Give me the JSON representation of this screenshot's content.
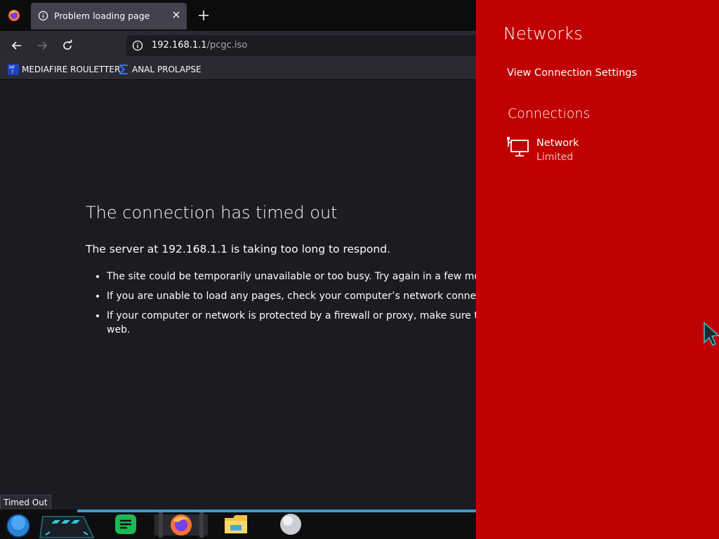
{
  "browser": {
    "tab": {
      "title": "Problem loading page"
    },
    "url": {
      "host": "192.168.1.1",
      "path": "/pcgc.iso"
    },
    "bookmarks": [
      {
        "label": "MEDIAFIRE ROULETTER",
        "icon": "mediafire-icon"
      },
      {
        "label": "ANAL PROLAPSE",
        "icon": "chevron-bookmark-icon"
      }
    ],
    "status_tooltip": "Timed Out"
  },
  "error_page": {
    "title": "The connection has timed out",
    "description": "The server at 192.168.1.1 is taking too long to respond.",
    "bullets": [
      "The site could be temporarily unavailable or too busy. Try again in a few momer",
      "If you are unable to load any pages, check your computer’s network connection.",
      "If your computer or network is protected by a firewall or proxy, make sure that F",
      "web."
    ]
  },
  "networks_panel": {
    "title": "Networks",
    "settings_link": "View Connection Settings",
    "connections_heading": "Connections",
    "connection": {
      "name": "Network",
      "status": "Limited"
    },
    "colors": {
      "background": "#c00000",
      "text": "#ffffff"
    }
  },
  "taskbar": {
    "icons": [
      "start-orb-icon",
      "task-view-icon",
      "spotify-icon",
      "firefox-icon",
      "file-explorer-icon",
      "app-orb-icon"
    ]
  },
  "colors": {
    "page_bg": "#1c1b22",
    "chrome_bg": "#2b2a33",
    "accent_blue": "#3a9cc9"
  }
}
